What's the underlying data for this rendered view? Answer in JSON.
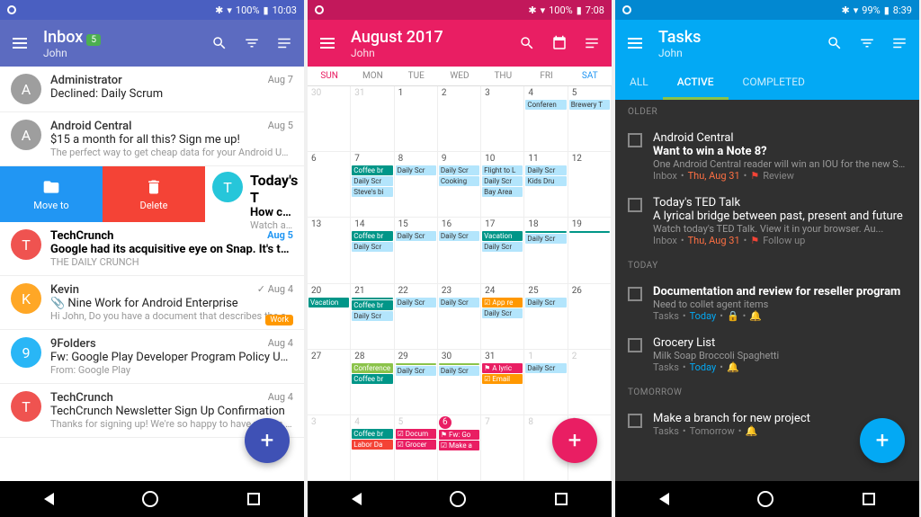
{
  "p1": {
    "status": {
      "battery": "100%",
      "time": "10:03"
    },
    "title": "Inbox",
    "badge": "5",
    "user": "John",
    "rows": [
      {
        "av": "A",
        "color": "#9e9e9e",
        "sender": "Administrator",
        "date": "Aug 7",
        "subj": "Declined: Daily Scrum",
        "prev": "",
        "icon": "calendar"
      },
      {
        "av": "A",
        "color": "#9e9e9e",
        "sender": "Android Central",
        "date": "Aug 5",
        "subj": "$15 a month for all this? Sign me up!",
        "prev": "The perfect way to get cheap data for your Android Unlimi..."
      },
      {
        "swipe": true,
        "moveto": "Move to",
        "delete": "Delete",
        "av": "T",
        "color": "#26c6da",
        "sender": "Today's T",
        "subj": "How comp",
        "prev": "Watch and s"
      },
      {
        "av": "T",
        "color": "#ef5350",
        "sender": "TechCrunch",
        "date": "Aug 5",
        "subj": "Google had its acquisitive eye on Snap. It's the Dai…",
        "prev": "THE DAILY CRUNCH",
        "bold": true,
        "dateblue": true
      },
      {
        "av": "K",
        "color": "#ffa726",
        "sender": "Kevin",
        "date": "Aug 4",
        "subj": "Nine Work for Android Enterprise",
        "prev": "Hi John, Do you have a document that describes the app c...",
        "check": true,
        "chip": "Work",
        "attach": true
      },
      {
        "av": "9",
        "color": "#29b6f6",
        "sender": "9Folders",
        "date": "Aug 4",
        "subj": "Fw: Google Play Developer Program Policy Update",
        "prev": "From: Google Play <noreply-developer-googleplay@google..."
      },
      {
        "av": "T",
        "color": "#ef5350",
        "sender": "TechCrunch",
        "date": "Aug 4",
        "subj": "TechCrunch Newsletter Sign Up Confirmation",
        "prev": "Thanks for signing up! We're so happy to have you on boa..."
      }
    ]
  },
  "p2": {
    "status": {
      "battery": "100%",
      "time": "7:08"
    },
    "title": "August 2017",
    "user": "John",
    "dow": [
      "SUN",
      "MON",
      "TUE",
      "WED",
      "THU",
      "FRI",
      "SAT"
    ],
    "weeks": [
      [
        {
          "d": "30",
          "dim": true
        },
        {
          "d": "31",
          "dim": true
        },
        {
          "d": "1"
        },
        {
          "d": "2"
        },
        {
          "d": "3"
        },
        {
          "d": "4",
          "ev": [
            [
              "Conferen",
              "e-lblue"
            ]
          ]
        },
        {
          "d": "5",
          "ev": [
            [
              "Brewery T",
              "e-lblue"
            ]
          ]
        }
      ],
      [
        {
          "d": "6"
        },
        {
          "d": "7",
          "ev": [
            [
              "Coffee br",
              "e-teal"
            ],
            [
              "Daily Scr",
              "e-lblue"
            ],
            [
              "Steve's bi",
              "e-lblue"
            ]
          ]
        },
        {
          "d": "8",
          "ev": [
            [
              "Daily Scr",
              "e-lblue"
            ]
          ]
        },
        {
          "d": "9",
          "ev": [
            [
              "Daily Scr",
              "e-lblue"
            ],
            [
              "Cooking",
              "e-lblue"
            ]
          ]
        },
        {
          "d": "10",
          "ev": [
            [
              "Flight to L",
              "e-lblue"
            ],
            [
              "Daily Scr",
              "e-lblue"
            ],
            [
              "Bay Area",
              "e-lblue"
            ]
          ]
        },
        {
          "d": "11",
          "ev": [
            [
              "Daily Scr",
              "e-lblue"
            ],
            [
              "Kids Dru",
              "e-lblue"
            ]
          ]
        },
        {
          "d": "12"
        }
      ],
      [
        {
          "d": "13"
        },
        {
          "d": "14",
          "ev": [
            [
              "Coffee br",
              "e-teal"
            ],
            [
              "Daily Scr",
              "e-lblue"
            ]
          ]
        },
        {
          "d": "15",
          "ev": [
            [
              "Daily Scr",
              "e-lblue"
            ]
          ]
        },
        {
          "d": "16",
          "ev": [
            [
              "Daily Scr",
              "e-lblue"
            ]
          ]
        },
        {
          "d": "17",
          "ev": [
            [
              "Vacation",
              "e-teal"
            ],
            [
              "Daily Scr",
              "e-lblue"
            ]
          ]
        },
        {
          "d": "18",
          "ev": [
            [
              "",
              "e-teal"
            ],
            [
              "Daily Scr",
              "e-lblue"
            ]
          ]
        },
        {
          "d": "19",
          "ev": [
            [
              "",
              "e-teal"
            ]
          ]
        }
      ],
      [
        {
          "d": "20",
          "ev": [
            [
              "Vacation",
              "e-teal"
            ]
          ]
        },
        {
          "d": "21",
          "ev": [
            [
              "",
              "e-teal"
            ],
            [
              "Coffee br",
              "e-teal"
            ],
            [
              "Daily Scr",
              "e-lblue"
            ]
          ]
        },
        {
          "d": "22",
          "ev": [
            [
              "Daily Scr",
              "e-lblue"
            ]
          ]
        },
        {
          "d": "23",
          "ev": [
            [
              "Daily Scr",
              "e-lblue"
            ]
          ]
        },
        {
          "d": "24",
          "ev": [
            [
              "☑ App re",
              "e-orange"
            ],
            [
              "Daily Scr",
              "e-lblue"
            ]
          ]
        },
        {
          "d": "25",
          "ev": [
            [
              "Daily Scr",
              "e-lblue"
            ]
          ]
        },
        {
          "d": "26"
        }
      ],
      [
        {
          "d": "27"
        },
        {
          "d": "28",
          "ev": [
            [
              "Conference",
              "e-green"
            ],
            [
              "Coffee br",
              "e-teal"
            ]
          ]
        },
        {
          "d": "29",
          "ev": [
            [
              "",
              "e-green"
            ],
            [
              "Daily Scr",
              "e-lblue"
            ]
          ]
        },
        {
          "d": "30",
          "ev": [
            [
              "",
              "e-green"
            ],
            [
              "Daily Scr",
              "e-lblue"
            ]
          ]
        },
        {
          "d": "31",
          "ev": [
            [
              "⚑ A lyric",
              "e-pink"
            ],
            [
              "☑ Email",
              "e-orange"
            ]
          ]
        },
        {
          "d": "1",
          "dim": true,
          "ev": [
            [
              "Daily Scr",
              "e-lblue"
            ]
          ]
        },
        {
          "d": "2",
          "dim": true
        }
      ],
      [
        {
          "d": "3",
          "dim": true
        },
        {
          "d": "4",
          "dim": true,
          "ev": [
            [
              "Coffee br",
              "e-teal"
            ],
            [
              "Labor Da",
              "e-red"
            ]
          ]
        },
        {
          "d": "5",
          "dim": true,
          "ev": [
            [
              "☑ Docum",
              "e-pink"
            ],
            [
              "☑ Grocer",
              "e-pink"
            ]
          ]
        },
        {
          "d": "6",
          "dim": true,
          "today": true,
          "ev": [
            [
              "⚑ Fw: Go",
              "e-pink"
            ],
            [
              "☑ Make a",
              "e-pink"
            ]
          ]
        },
        {
          "d": "7",
          "dim": true
        },
        {
          "d": "8",
          "dim": true
        },
        {
          "d": "9",
          "dim": true
        }
      ]
    ]
  },
  "p3": {
    "status": {
      "battery": "99%",
      "time": "8:39"
    },
    "title": "Tasks",
    "user": "John",
    "tabs": [
      "ALL",
      "ACTIVE",
      "COMPLETED"
    ],
    "activeTab": 1,
    "sections": [
      {
        "label": "OLDER",
        "items": [
          {
            "sender": "Android Central",
            "title": "Want to win a Note 8?",
            "prev": "One Android Central reader will win an IOU for the new Samsu...",
            "folder": "Inbox",
            "due": "Thu, Aug 31",
            "flag": "Review",
            "bold": true
          },
          {
            "sender": "Today's TED Talk",
            "title": "A lyrical bridge between past, present and future",
            "prev": "Watch today's TED Talk. View it in your browser. Au...",
            "folder": "Inbox",
            "due": "Thu, Aug 31",
            "flag": "Follow up"
          }
        ]
      },
      {
        "label": "TODAY",
        "items": [
          {
            "title": "Documentation and review for reseller program",
            "prev": "Need to collet agent items",
            "folder": "Tasks",
            "due2": "Today",
            "icons": [
              "lock",
              "bell"
            ],
            "bold": true
          },
          {
            "title": "Grocery List",
            "prev": "Milk Soap Broccoli Spaghetti",
            "folder": "Tasks",
            "due2": "Today",
            "icons": [
              "bell"
            ]
          }
        ]
      },
      {
        "label": "TOMORROW",
        "items": [
          {
            "title": "Make a branch for new project",
            "folder": "Tasks",
            "due3": "Tomorrow",
            "icons": [
              "bell"
            ]
          }
        ]
      }
    ]
  }
}
